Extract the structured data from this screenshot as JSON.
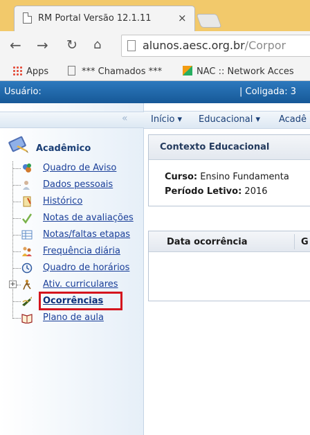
{
  "browser": {
    "tab_title": "RM Portal Versão 12.1.11",
    "tab_close": "×",
    "url_host": "alunos.aesc.org.br",
    "url_path": "/Corpor",
    "bookmarks": {
      "apps": "Apps",
      "chamados": "*** Chamados ***",
      "nac": "NAC :: Network Acces"
    }
  },
  "header": {
    "user_label": "Usuário:",
    "coligada_label": "| Coligada: 3"
  },
  "sidebar": {
    "collapse_icon": "chevron-double-left-icon",
    "collapse_glyph": "«",
    "section_title": "Acadêmico",
    "items": [
      {
        "label": "Quadro de Aviso",
        "icon": "bulletin-icon"
      },
      {
        "label": "Dados pessoais",
        "icon": "person-icon"
      },
      {
        "label": "Histórico",
        "icon": "history-icon"
      },
      {
        "label": "Notas de avaliações",
        "icon": "grades-icon"
      },
      {
        "label": "Notas/faltas etapas",
        "icon": "table-icon"
      },
      {
        "label": "Frequência diária",
        "icon": "attendance-icon"
      },
      {
        "label": "Quadro de horários",
        "icon": "clock-icon"
      },
      {
        "label": "Ativ. curriculares",
        "icon": "activities-icon"
      },
      {
        "label": "Ocorrências",
        "icon": "occurrences-icon"
      },
      {
        "label": "Plano de aula",
        "icon": "book-icon"
      }
    ]
  },
  "breadcrumb": {
    "items": [
      "Início ▾",
      "Educacional ▾",
      "Acadê"
    ]
  },
  "context_panel": {
    "title": "Contexto Educacional",
    "curso_label": "Curso:",
    "curso_value": "Ensino Fundamenta",
    "periodo_label": "Período Letivo:",
    "periodo_value": "2016"
  },
  "grid": {
    "columns": [
      "Data ocorrência",
      "G"
    ]
  },
  "colors": {
    "header_blue": "#1f66aa",
    "link_blue": "#1a3f99",
    "highlight_red": "#d4141d",
    "tabstrip": "#f2c96b"
  }
}
